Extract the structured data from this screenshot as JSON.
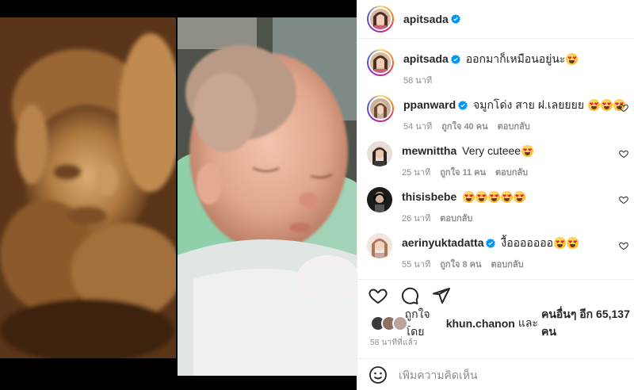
{
  "post": {
    "author": "apitsada",
    "caption_text": "ออกมาก็เหมือนอยู่นะ",
    "caption_time": "58 นาที"
  },
  "comments": [
    {
      "user": "ppanward",
      "verified": true,
      "text": "จมูกโด่ง สาย ฝ.เลยยยย ",
      "emoji_count": 3,
      "time": "54 นาที",
      "likes": "ถูกใจ 40 คน",
      "reply": "ตอบกลับ"
    },
    {
      "user": "mewnittha",
      "verified": false,
      "text": "Very cuteee",
      "emoji_count": 1,
      "time": "25 นาที",
      "likes": "ถูกใจ 11 คน",
      "reply": "ตอบกลับ"
    },
    {
      "user": "thisisbebe",
      "verified": false,
      "text": "",
      "emoji_count": 5,
      "time": "26 นาที",
      "likes": "",
      "reply": "ตอบกลับ"
    },
    {
      "user": "aerinyuktadatta",
      "verified": true,
      "text": "งื้อออออออ",
      "emoji_count": 2,
      "time": "55 นาที",
      "likes": "ถูกใจ 8 คน",
      "reply": "ตอบกลับ"
    }
  ],
  "likes_line": {
    "prefix": "ถูกใจโดย",
    "user": "khun.chanon",
    "middle": "และ",
    "others": "คนอื่นๆ อีก 65,137 คน"
  },
  "posted_ago": "58 นาทีที่แล้ว",
  "comment_input": {
    "placeholder": "เพิ่มความคิดเห็น"
  },
  "icons": [
    "heart-icon",
    "comment-icon",
    "share-icon",
    "emoji-icon",
    "verified-icon"
  ],
  "colors": {
    "verified": "#0095f6",
    "text": "#262626",
    "muted": "#8e8e8e",
    "border": "#efefef"
  }
}
